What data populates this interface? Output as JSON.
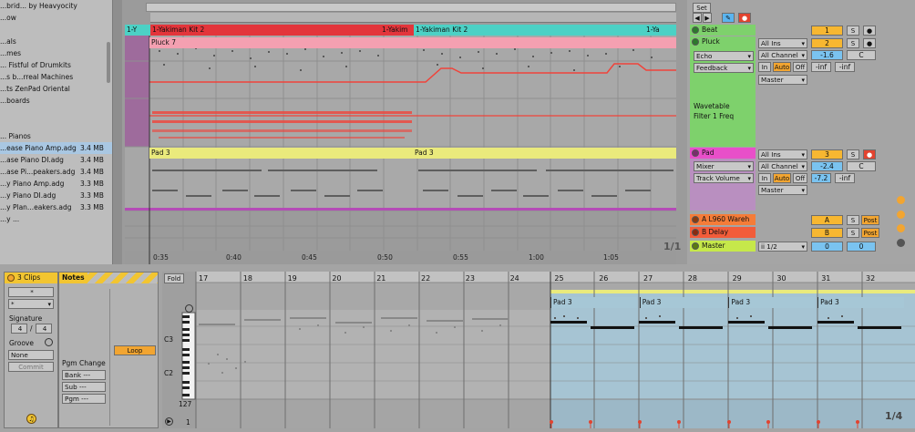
{
  "browser": {
    "items": [
      {
        "name": "...brid... by Heavyocity",
        "size": ""
      },
      {
        "name": "...ow",
        "size": ""
      },
      {
        "name": "",
        "size": ""
      },
      {
        "name": "...als",
        "size": ""
      },
      {
        "name": "...mes",
        "size": ""
      },
      {
        "name": "... Fistful of Drumkits",
        "size": ""
      },
      {
        "name": "...s b...rreal Machines",
        "size": ""
      },
      {
        "name": "...ts ZenPad Oriental",
        "size": ""
      },
      {
        "name": "...boards",
        "size": ""
      },
      {
        "name": "",
        "size": ""
      },
      {
        "name": "",
        "size": ""
      },
      {
        "name": "... Pianos",
        "size": ""
      },
      {
        "name": "...ease Piano Amp.adg",
        "size": "3.4 MB"
      },
      {
        "name": "...ase Piano DI.adg",
        "size": "3.4 MB"
      },
      {
        "name": "...ase Pi...peakers.adg",
        "size": "3.4 MB"
      },
      {
        "name": "...y Piano Amp.adg",
        "size": "3.3 MB"
      },
      {
        "name": "...y Piano DI.adg",
        "size": "3.3 MB"
      },
      {
        "name": "...y Plan...eakers.adg",
        "size": "3.3 MB"
      },
      {
        "name": "...y ...",
        "size": ""
      }
    ]
  },
  "arrangement": {
    "beat_clips": [
      "1-Y",
      "1-Yakiman Kit 2",
      "1-Yakim",
      "1-Yakiman Kit 2",
      "1-Ya"
    ],
    "pluck_clip": "Pluck 7",
    "pad_clips": [
      "Pad 3",
      "Pad 3"
    ],
    "ruler": [
      "0:35",
      "0:40",
      "0:45",
      "0:50",
      "0:55",
      "1:00",
      "1:05"
    ],
    "page": "1/1"
  },
  "mixer": {
    "set_label": "Set",
    "tracks": {
      "beat": {
        "name": "Beat",
        "num": "1",
        "s": "S"
      },
      "pluck": {
        "name": "Pluck",
        "input": "All Ins",
        "channel": "All Channel",
        "num": "2",
        "s": "S",
        "vol": "-1.6",
        "pan": "C",
        "send1": "-inf",
        "send2": "-inf",
        "in": "In",
        "auto": "Auto",
        "off": "Off",
        "out": "Master"
      },
      "pluck_devices": [
        "Echo",
        "Feedback"
      ],
      "pluck_param": "Wavetable Filter 1 Freq",
      "pad": {
        "name": "Pad",
        "input": "All Ins",
        "channel": "All Channel",
        "num": "3",
        "s": "S",
        "vol": "-2.4",
        "pan": "C",
        "send1": "-7.2",
        "send2": "-inf",
        "in": "In",
        "auto": "Auto",
        "off": "Off",
        "out": "Master"
      },
      "pad_devices": [
        "Mixer",
        "Track Volume"
      ],
      "ret_a": {
        "name": "A L960 Wareh",
        "num": "A",
        "s": "S",
        "post": "Post"
      },
      "ret_b": {
        "name": "B Delay",
        "num": "B",
        "s": "S",
        "post": "Post"
      },
      "master": {
        "name": "Master",
        "cue": "ii 1/2",
        "vol": "0",
        "pan": "0"
      }
    }
  },
  "clip": {
    "header": "3 Clips",
    "notes_header": "Notes",
    "dd1": "*",
    "dd2": "*",
    "signature_label": "Signature",
    "sig_num": "4",
    "sig_den": "4",
    "groove_label": "Groove",
    "groove_value": "None",
    "commit": "Commit",
    "loop": "Loop",
    "pgm_label": "Pgm Change",
    "bank": "Bank ---",
    "sub": "Sub ---",
    "pgm": "Pgm ---",
    "fold": "Fold",
    "bars": [
      "17",
      "18",
      "19",
      "20",
      "21",
      "22",
      "23",
      "24",
      "25",
      "26",
      "27",
      "28",
      "29",
      "30",
      "31",
      "32"
    ],
    "pad_clips": [
      "Pad 3",
      "Pad 3",
      "Pad 3",
      "Pad 3"
    ],
    "c3": "C3",
    "c2": "C2",
    "vel_max": "127",
    "vel_min": "1",
    "page": "1/4"
  }
}
